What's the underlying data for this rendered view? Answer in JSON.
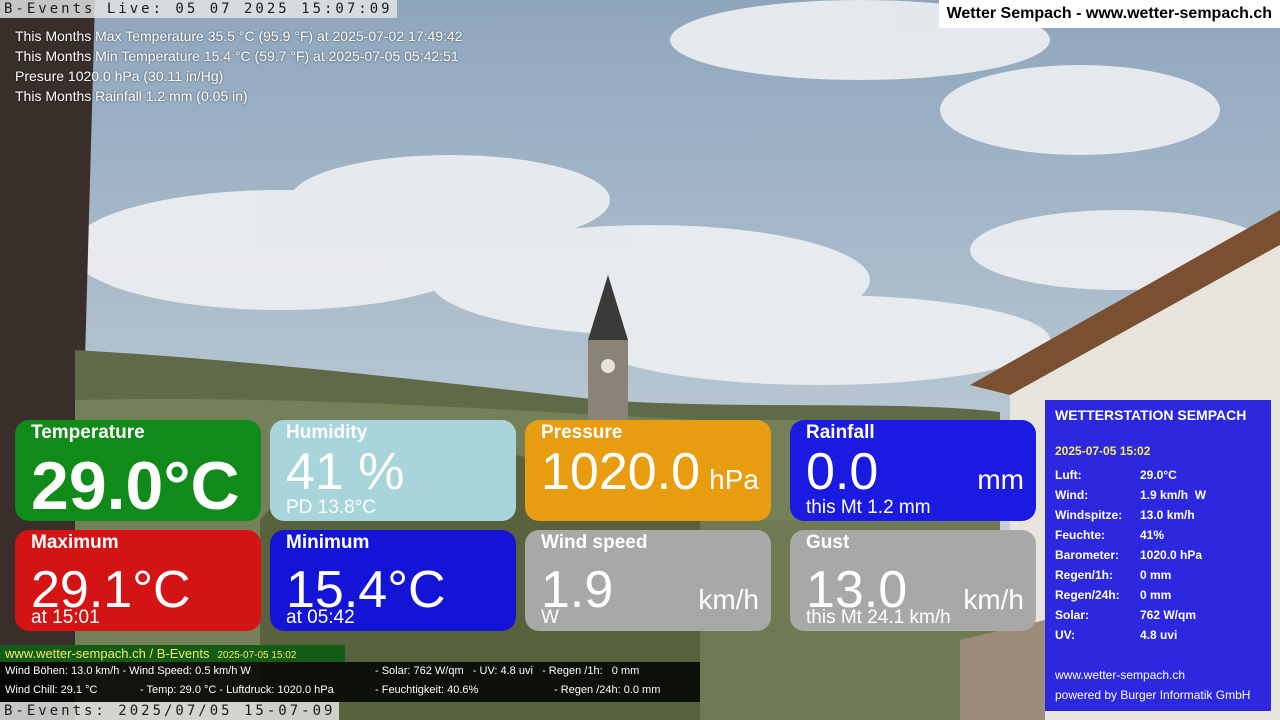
{
  "overlay": {
    "cam_top": "B-Events Live: 05 07 2025 15:07:09",
    "cam_bottom": "B-Events: 2025/07/05 15-07-09",
    "site_title": "Wetter Sempach - www.wetter-sempach.ch"
  },
  "stats": {
    "max_temp": "This Months Max Temperature 35.5 °C (95.9 °F) at 2025-07-02 17:49:42",
    "min_temp": "This Months Min Temperature 15.4 °C (59.7 °F) at 2025-07-05 05:42:51",
    "pressure": "Presure 1020.0 hPa (30.11 in/Hg)",
    "rainfall": "This Months Rainfall 1.2 mm (0.05 in)"
  },
  "tiles": {
    "temperature": {
      "title": "Temperature",
      "value": "29.0°C",
      "color": "#108a18"
    },
    "humidity": {
      "title": "Humidity",
      "value": "41 %",
      "sub": "PD 13.8°C",
      "color": "#a8d4dc"
    },
    "pressure": {
      "title": "Pressure",
      "value": "1020.0",
      "unit": "hPa",
      "color": "#e89c10"
    },
    "rainfall": {
      "title": "Rainfall",
      "value": "0.0",
      "unit": "mm",
      "sub": "this Mt 1.2 mm",
      "color": "#1a1ae0"
    },
    "maximum": {
      "title": "Maximum",
      "value": "29.1°C",
      "sub": "at 15:01",
      "color": "#d41414"
    },
    "minimum": {
      "title": "Minimum",
      "value": "15.4°C",
      "sub": "at 05:42",
      "color": "#1414d6"
    },
    "wind_speed": {
      "title": "Wind speed",
      "value": "1.9",
      "unit": "km/h",
      "sub": "W",
      "color": "#a8a8a8"
    },
    "gust": {
      "title": "Gust",
      "value": "13.0",
      "unit": "km/h",
      "sub": "this Mt 24.1 km/h",
      "color": "#a8a8a8"
    }
  },
  "panel": {
    "title": "WETTERSTATION SEMPACH",
    "date": "2025-07-05 15:02",
    "rows": [
      {
        "k": "Luft:",
        "v": "29.0°C"
      },
      {
        "k": "Wind:",
        "v": "1.9 km/h  W"
      },
      {
        "k": "Windspitze:",
        "v": "13.0 km/h"
      },
      {
        "k": "Feuchte:",
        "v": "41%"
      },
      {
        "k": "Barometer:",
        "v": "1020.0 hPa"
      },
      {
        "k": "Regen/1h:",
        "v": "0 mm"
      },
      {
        "k": "Regen/24h:",
        "v": "0 mm"
      },
      {
        "k": "Solar:",
        "v": "762 W/qm"
      },
      {
        "k": "UV:",
        "v": "4.8 uvi"
      }
    ],
    "footer_url": "www.wetter-sempach.ch",
    "footer_powered": "powered by Burger Informatik GmbH"
  },
  "ticker": {
    "head": "www.wetter-sempach.ch / B-Events",
    "head_date": "2025-07-05 15:02",
    "l1a": "Wind Böhen: 13.0 km/h   - Wind Speed: 0.5 km/h W",
    "l1b": "- Solar: 762 W/qm   - UV: 4.8 uvi   - Regen /1h:   0 mm",
    "l2a": "Wind Chill: 29.1 °C",
    "l2b": "- Temp: 29.0 °C  - Luftdruck: 1020.0 hPa",
    "l2c": "- Feuchtigkeit: 40.6%",
    "l2d": "- Regen /24h: 0.0 mm"
  }
}
